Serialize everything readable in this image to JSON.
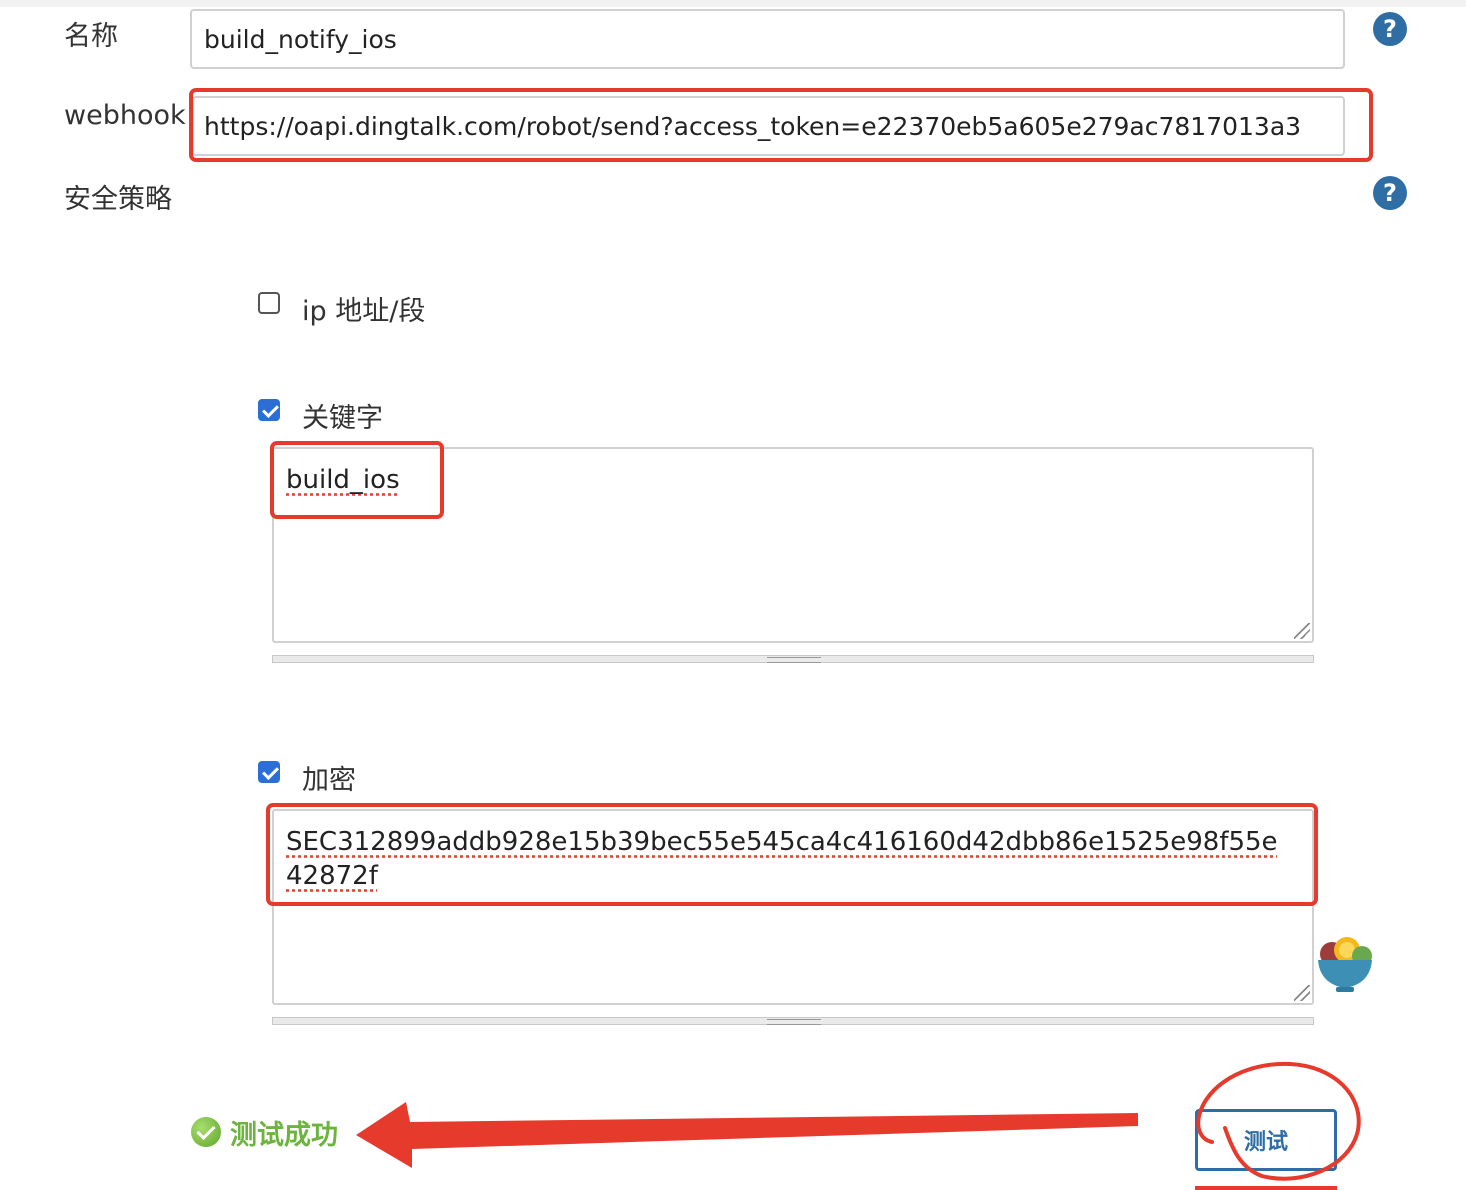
{
  "form": {
    "name_label": "名称",
    "name_value": "build_notify_ios",
    "webhook_label": "webhook",
    "webhook_value": "https://oapi.dingtalk.com/robot/send?access_token=e22370eb5a605e279ac7817013a3",
    "security_label": "安全策略",
    "help_glyph": "?"
  },
  "security": {
    "ip": {
      "label": "ip 地址/段",
      "checked": false
    },
    "keyword": {
      "label": "关键字",
      "checked": true,
      "value": "build_ios"
    },
    "encrypt": {
      "label": "加密",
      "checked": true,
      "line1": "SEC312899addb928e15b39bec55e545ca4c416160d42dbb86e1525e98f55e",
      "line2": "42872f"
    }
  },
  "test": {
    "status_text": "测试成功",
    "button_label": "测试"
  },
  "colors": {
    "accent": "#2f6da5",
    "success": "#6db33f",
    "annotation_red": "#e53a2c",
    "checkbox_blue": "#2b6fd6"
  }
}
